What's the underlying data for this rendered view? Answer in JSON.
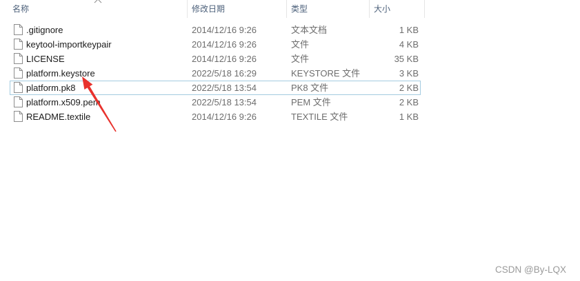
{
  "columns": {
    "name": "名称",
    "modified": "修改日期",
    "type": "类型",
    "size": "大小"
  },
  "header_icons": {
    "sort_indicator": "chevron-up-icon"
  },
  "files": [
    {
      "name": ".gitignore",
      "modified": "2014/12/16 9:26",
      "type": "文本文档",
      "size": "1 KB",
      "icon": "document-icon",
      "focused": false
    },
    {
      "name": "keytool-importkeypair",
      "modified": "2014/12/16 9:26",
      "type": "文件",
      "size": "4 KB",
      "icon": "document-icon",
      "focused": false
    },
    {
      "name": "LICENSE",
      "modified": "2014/12/16 9:26",
      "type": "文件",
      "size": "35 KB",
      "icon": "document-icon",
      "focused": false
    },
    {
      "name": "platform.keystore",
      "modified": "2022/5/18 16:29",
      "type": "KEYSTORE 文件",
      "size": "3 KB",
      "icon": "document-icon",
      "focused": false
    },
    {
      "name": "platform.pk8",
      "modified": "2022/5/18 13:54",
      "type": "PK8 文件",
      "size": "2 KB",
      "icon": "document-icon",
      "focused": true
    },
    {
      "name": "platform.x509.pem",
      "modified": "2022/5/18 13:54",
      "type": "PEM 文件",
      "size": "2 KB",
      "icon": "document-icon",
      "focused": false
    },
    {
      "name": "README.textile",
      "modified": "2014/12/16 9:26",
      "type": "TEXTILE 文件",
      "size": "1 KB",
      "icon": "document-icon",
      "focused": false
    }
  ],
  "watermark": "CSDN @By-LQX",
  "colors": {
    "header_text": "#4c607a",
    "name_text": "#1a1a1a",
    "detail_text": "#6d6d6d",
    "focus_border": "#a3cbe0",
    "annotation_arrow": "#e8322d"
  }
}
